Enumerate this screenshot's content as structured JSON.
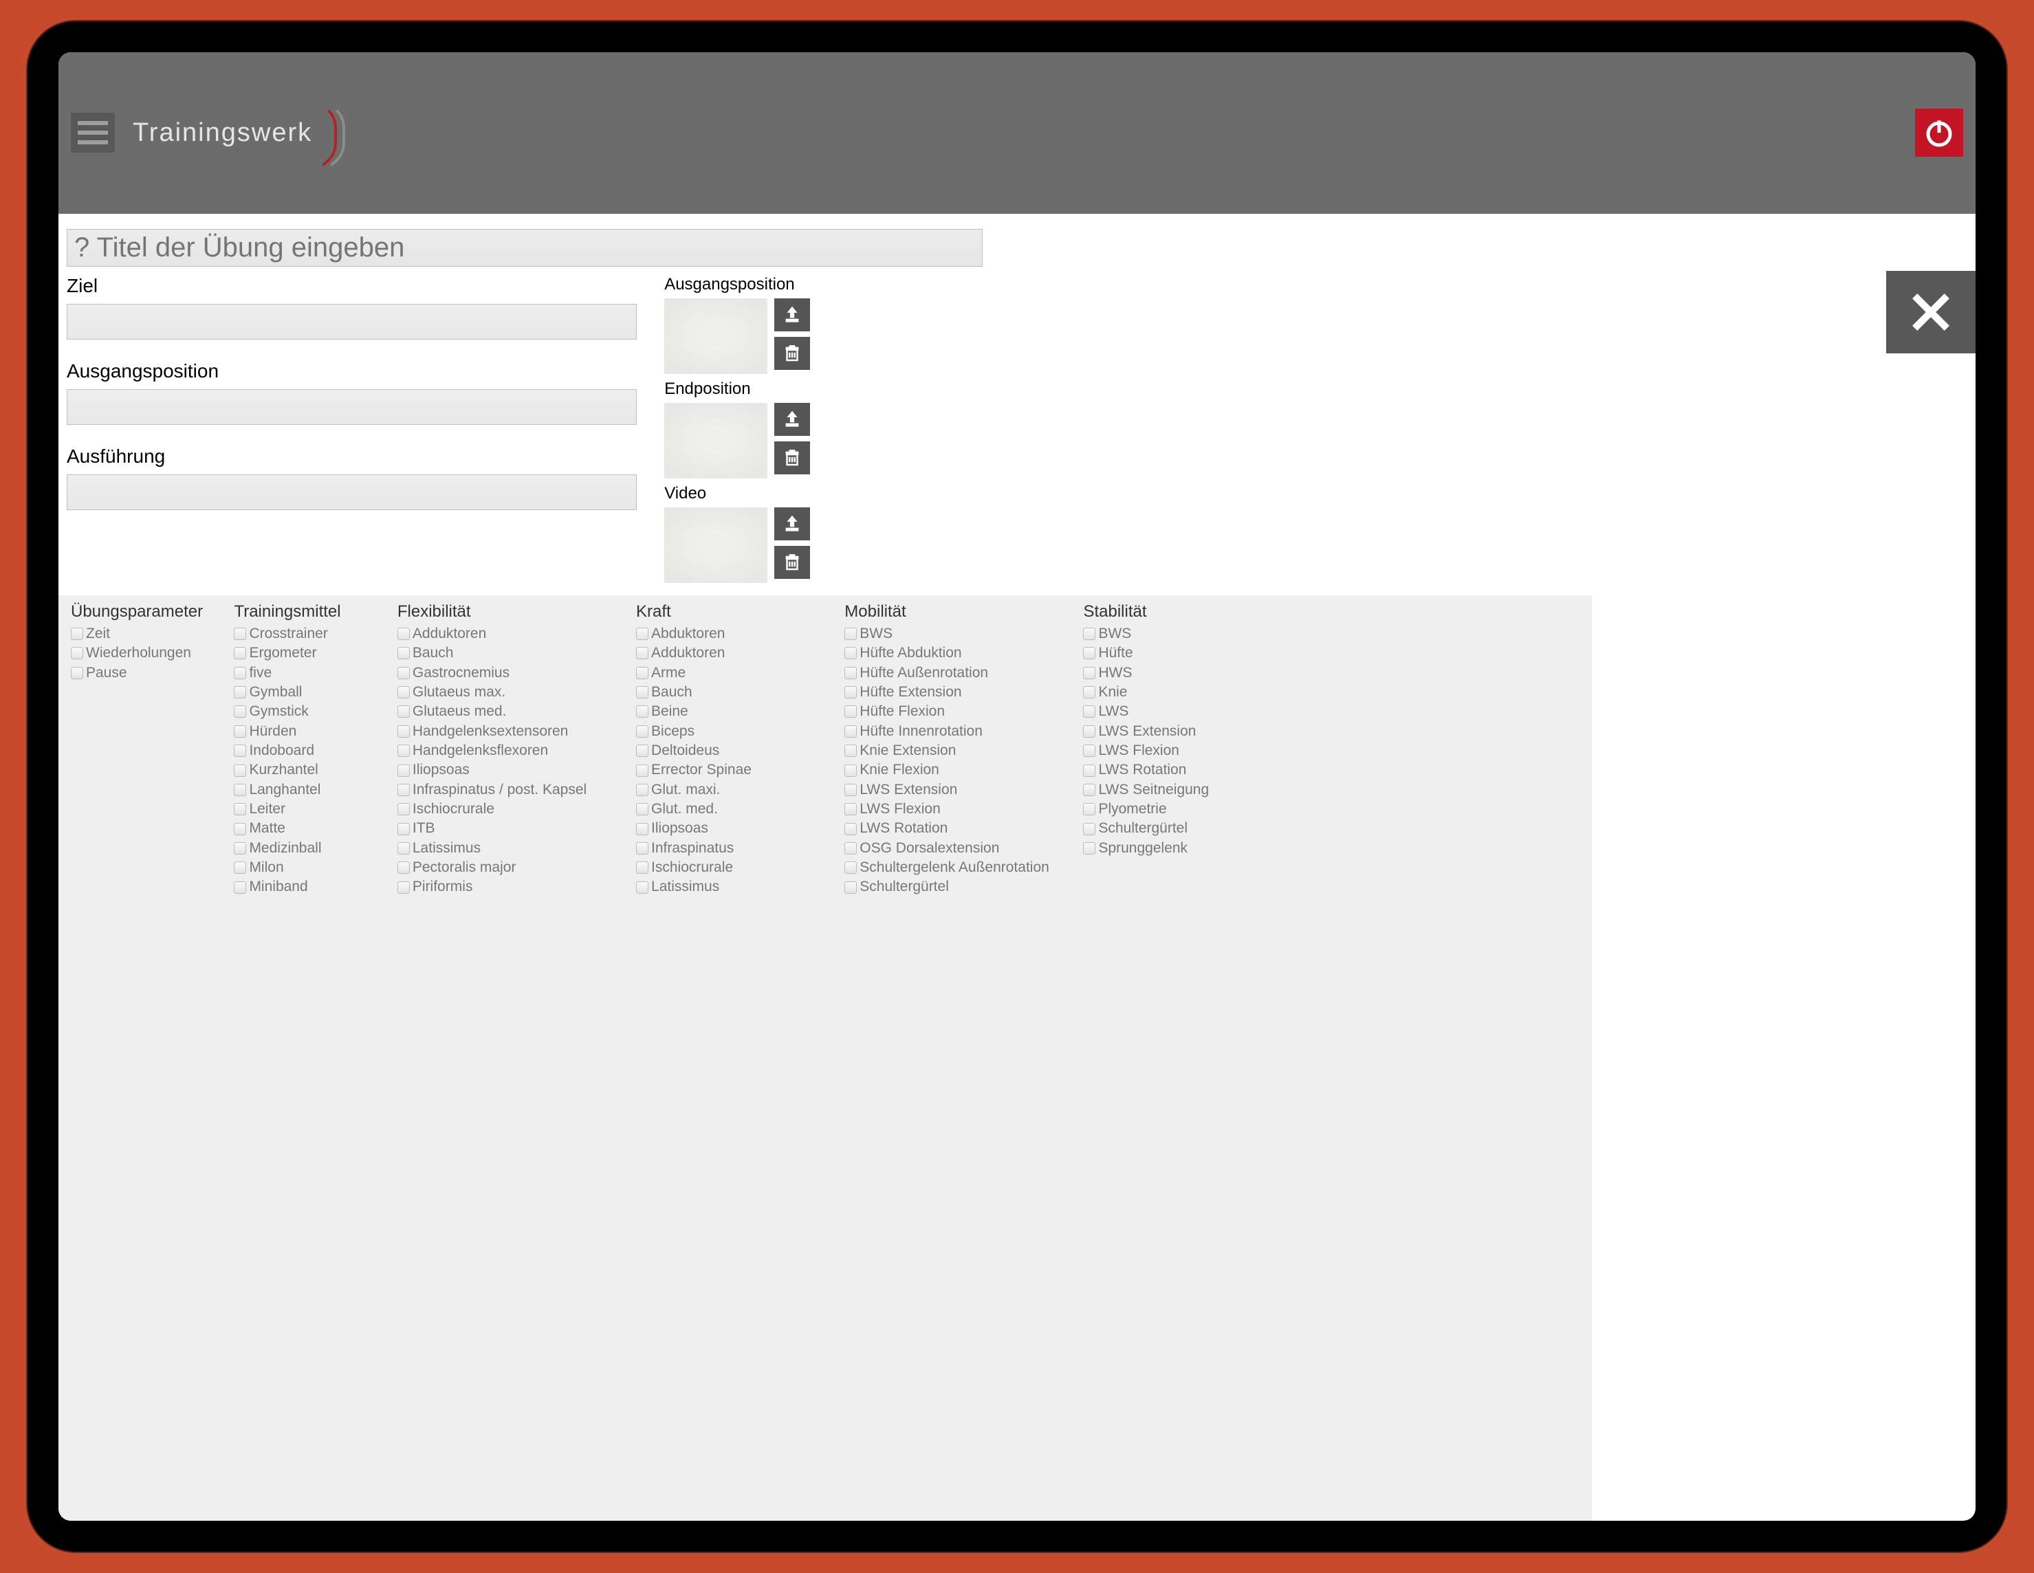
{
  "brand": "Trainingswerk",
  "title_placeholder": "? Titel der Übung eingeben",
  "fields": {
    "ziel": "Ziel",
    "ausgangsposition": "Ausgangsposition",
    "ausfuehrung": "Ausführung"
  },
  "media": {
    "ausgangsposition": "Ausgangsposition",
    "endposition": "Endposition",
    "video": "Video"
  },
  "check_groups": [
    {
      "title": "Übungsparameter",
      "items": [
        "Zeit",
        "Wiederholungen",
        "Pause"
      ]
    },
    {
      "title": "Trainingsmittel",
      "items": [
        "Crosstrainer",
        "Ergometer",
        "five",
        "Gymball",
        "Gymstick",
        "Hürden",
        "Indoboard",
        "Kurzhantel",
        "Langhantel",
        "Leiter",
        "Matte",
        "Medizinball",
        "Milon",
        "Miniband"
      ]
    },
    {
      "title": "Flexibilität",
      "items": [
        "Adduktoren",
        "Bauch",
        "Gastrocnemius",
        "Glutaeus max.",
        "Glutaeus med.",
        "Handgelenksextensoren",
        "Handgelenksflexoren",
        "Iliopsoas",
        "Infraspinatus / post. Kapsel",
        "Ischiocrurale",
        "ITB",
        "Latissimus",
        "Pectoralis major",
        "Piriformis"
      ]
    },
    {
      "title": "Kraft",
      "items": [
        "Abduktoren",
        "Adduktoren",
        "Arme",
        "Bauch",
        "Beine",
        "Biceps",
        "Deltoideus",
        "Errector Spinae",
        "Glut. maxi.",
        "Glut. med.",
        "Iliopsoas",
        "Infraspinatus",
        "Ischiocrurale",
        "Latissimus"
      ]
    },
    {
      "title": "Mobilität",
      "items": [
        "BWS",
        "Hüfte Abduktion",
        "Hüfte Außenrotation",
        "Hüfte Extension",
        "Hüfte Flexion",
        "Hüfte Innenrotation",
        "Knie Extension",
        "Knie Flexion",
        "LWS Extension",
        "LWS Flexion",
        "LWS Rotation",
        "OSG Dorsalextension",
        "Schultergelenk Außenrotation",
        "Schultergürtel"
      ]
    },
    {
      "title": "Stabilität",
      "items": [
        "BWS",
        "Hüfte",
        "HWS",
        "Knie",
        "LWS",
        "LWS Extension",
        "LWS Flexion",
        "LWS Rotation",
        "LWS Seitneigung",
        "Plyometrie",
        "Schultergürtel",
        "Sprunggelenk"
      ]
    }
  ],
  "icons": {
    "menu": "menu-icon",
    "power": "power-icon",
    "upload": "upload-icon",
    "trash": "trash-icon",
    "close": "close-icon"
  },
  "colors": {
    "accent_red": "#c41425",
    "header_grey": "#6c6c6c",
    "panel_grey": "#585858",
    "bg_orange": "#c84a2c"
  }
}
